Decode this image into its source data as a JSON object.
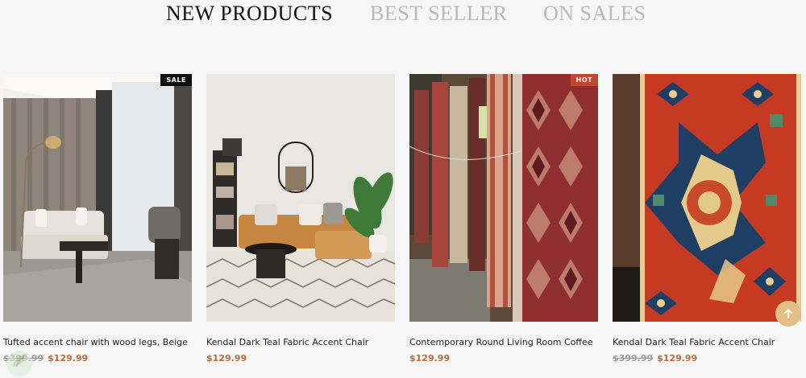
{
  "tabs": [
    {
      "label": "NEW PRODUCTS",
      "active": true
    },
    {
      "label": "BEST SELLER",
      "active": false
    },
    {
      "label": "ON SALES",
      "active": false
    }
  ],
  "colors": {
    "accent": "#b46d3f",
    "sale_badge": "#111111",
    "hot_badge": "#c0462f",
    "scroll_top": "#e3bf86"
  },
  "products": [
    {
      "name": "Tufted accent chair with wood legs, Beige",
      "old_price": "$399.99",
      "price": "$129.99",
      "badge": "SALE"
    },
    {
      "name": "Kendal Dark Teal Fabric Accent Chair",
      "old_price": "",
      "price": "$129.99",
      "badge": ""
    },
    {
      "name": "Contemporary Round Living Room Coffee",
      "old_price": "",
      "price": "$129.99",
      "badge": "HOT"
    },
    {
      "name": "Kendal Dark Teal Fabric Accent Chair",
      "old_price": "$399.99",
      "price": "$129.99",
      "badge": ""
    }
  ],
  "scroll_top": {
    "icon": "arrow-up-icon"
  },
  "logo": {
    "icon": "leaf-logo-icon"
  }
}
